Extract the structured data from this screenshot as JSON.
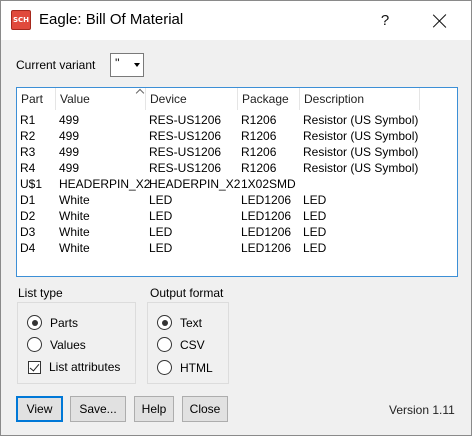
{
  "window": {
    "title": "Eagle: Bill Of Material",
    "icon_text": "SCH",
    "help_glyph": "?"
  },
  "variant": {
    "label": "Current variant",
    "selected": "''"
  },
  "table": {
    "columns": [
      "Part",
      "Value",
      "Device",
      "Package",
      "Description"
    ],
    "sorted_column": "Value",
    "rows": [
      [
        "R1",
        "499",
        "RES-US1206",
        "R1206",
        "Resistor (US Symbol)"
      ],
      [
        "R2",
        "499",
        "RES-US1206",
        "R1206",
        "Resistor (US Symbol)"
      ],
      [
        "R3",
        "499",
        "RES-US1206",
        "R1206",
        "Resistor (US Symbol)"
      ],
      [
        "R4",
        "499",
        "RES-US1206",
        "R1206",
        "Resistor (US Symbol)"
      ],
      [
        "U$1",
        "HEADERPIN_X2",
        "HEADERPIN_X2",
        "1X02SMD",
        ""
      ],
      [
        "D1",
        "White",
        "LED",
        "LED1206",
        "LED"
      ],
      [
        "D2",
        "White",
        "LED",
        "LED1206",
        "LED"
      ],
      [
        "D3",
        "White",
        "LED",
        "LED1206",
        "LED"
      ],
      [
        "D4",
        "White",
        "LED",
        "LED1206",
        "LED"
      ]
    ]
  },
  "list_type": {
    "label": "List type",
    "options": [
      "Parts",
      "Values"
    ],
    "selected": "Parts",
    "attributes_label": "List attributes",
    "attributes_checked": true
  },
  "output_format": {
    "label": "Output format",
    "options": [
      "Text",
      "CSV",
      "HTML"
    ],
    "selected": "Text"
  },
  "buttons": {
    "view": "View",
    "save": "Save...",
    "help": "Help",
    "close": "Close"
  },
  "version": "Version 1.11",
  "colors": {
    "focus_border": "#0078d7",
    "list_border": "#3c8fd6",
    "icon_red": "#e04a3c"
  }
}
